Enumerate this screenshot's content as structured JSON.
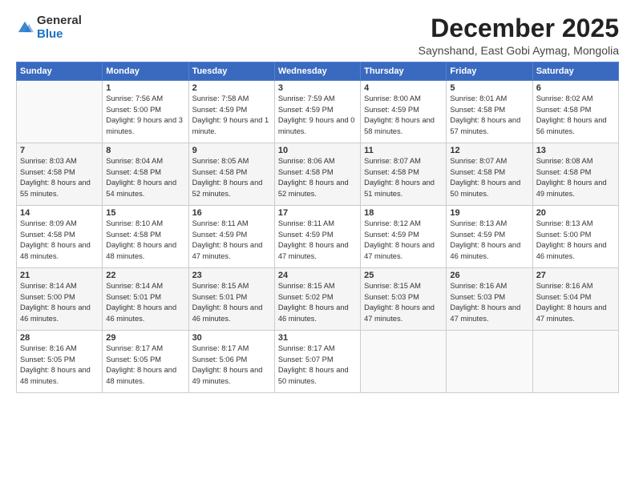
{
  "logo": {
    "general": "General",
    "blue": "Blue"
  },
  "title": "December 2025",
  "subtitle": "Saynshand, East Gobi Aymag, Mongolia",
  "headers": [
    "Sunday",
    "Monday",
    "Tuesday",
    "Wednesday",
    "Thursday",
    "Friday",
    "Saturday"
  ],
  "weeks": [
    [
      {
        "day": "",
        "info": ""
      },
      {
        "day": "1",
        "info": "Sunrise: 7:56 AM\nSunset: 5:00 PM\nDaylight: 9 hours\nand 3 minutes."
      },
      {
        "day": "2",
        "info": "Sunrise: 7:58 AM\nSunset: 4:59 PM\nDaylight: 9 hours\nand 1 minute."
      },
      {
        "day": "3",
        "info": "Sunrise: 7:59 AM\nSunset: 4:59 PM\nDaylight: 9 hours\nand 0 minutes."
      },
      {
        "day": "4",
        "info": "Sunrise: 8:00 AM\nSunset: 4:59 PM\nDaylight: 8 hours\nand 58 minutes."
      },
      {
        "day": "5",
        "info": "Sunrise: 8:01 AM\nSunset: 4:58 PM\nDaylight: 8 hours\nand 57 minutes."
      },
      {
        "day": "6",
        "info": "Sunrise: 8:02 AM\nSunset: 4:58 PM\nDaylight: 8 hours\nand 56 minutes."
      }
    ],
    [
      {
        "day": "7",
        "info": "Sunrise: 8:03 AM\nSunset: 4:58 PM\nDaylight: 8 hours\nand 55 minutes."
      },
      {
        "day": "8",
        "info": "Sunrise: 8:04 AM\nSunset: 4:58 PM\nDaylight: 8 hours\nand 54 minutes."
      },
      {
        "day": "9",
        "info": "Sunrise: 8:05 AM\nSunset: 4:58 PM\nDaylight: 8 hours\nand 52 minutes."
      },
      {
        "day": "10",
        "info": "Sunrise: 8:06 AM\nSunset: 4:58 PM\nDaylight: 8 hours\nand 52 minutes."
      },
      {
        "day": "11",
        "info": "Sunrise: 8:07 AM\nSunset: 4:58 PM\nDaylight: 8 hours\nand 51 minutes."
      },
      {
        "day": "12",
        "info": "Sunrise: 8:07 AM\nSunset: 4:58 PM\nDaylight: 8 hours\nand 50 minutes."
      },
      {
        "day": "13",
        "info": "Sunrise: 8:08 AM\nSunset: 4:58 PM\nDaylight: 8 hours\nand 49 minutes."
      }
    ],
    [
      {
        "day": "14",
        "info": "Sunrise: 8:09 AM\nSunset: 4:58 PM\nDaylight: 8 hours\nand 48 minutes."
      },
      {
        "day": "15",
        "info": "Sunrise: 8:10 AM\nSunset: 4:58 PM\nDaylight: 8 hours\nand 48 minutes."
      },
      {
        "day": "16",
        "info": "Sunrise: 8:11 AM\nSunset: 4:59 PM\nDaylight: 8 hours\nand 47 minutes."
      },
      {
        "day": "17",
        "info": "Sunrise: 8:11 AM\nSunset: 4:59 PM\nDaylight: 8 hours\nand 47 minutes."
      },
      {
        "day": "18",
        "info": "Sunrise: 8:12 AM\nSunset: 4:59 PM\nDaylight: 8 hours\nand 47 minutes."
      },
      {
        "day": "19",
        "info": "Sunrise: 8:13 AM\nSunset: 4:59 PM\nDaylight: 8 hours\nand 46 minutes."
      },
      {
        "day": "20",
        "info": "Sunrise: 8:13 AM\nSunset: 5:00 PM\nDaylight: 8 hours\nand 46 minutes."
      }
    ],
    [
      {
        "day": "21",
        "info": "Sunrise: 8:14 AM\nSunset: 5:00 PM\nDaylight: 8 hours\nand 46 minutes."
      },
      {
        "day": "22",
        "info": "Sunrise: 8:14 AM\nSunset: 5:01 PM\nDaylight: 8 hours\nand 46 minutes."
      },
      {
        "day": "23",
        "info": "Sunrise: 8:15 AM\nSunset: 5:01 PM\nDaylight: 8 hours\nand 46 minutes."
      },
      {
        "day": "24",
        "info": "Sunrise: 8:15 AM\nSunset: 5:02 PM\nDaylight: 8 hours\nand 46 minutes."
      },
      {
        "day": "25",
        "info": "Sunrise: 8:15 AM\nSunset: 5:03 PM\nDaylight: 8 hours\nand 47 minutes."
      },
      {
        "day": "26",
        "info": "Sunrise: 8:16 AM\nSunset: 5:03 PM\nDaylight: 8 hours\nand 47 minutes."
      },
      {
        "day": "27",
        "info": "Sunrise: 8:16 AM\nSunset: 5:04 PM\nDaylight: 8 hours\nand 47 minutes."
      }
    ],
    [
      {
        "day": "28",
        "info": "Sunrise: 8:16 AM\nSunset: 5:05 PM\nDaylight: 8 hours\nand 48 minutes."
      },
      {
        "day": "29",
        "info": "Sunrise: 8:17 AM\nSunset: 5:05 PM\nDaylight: 8 hours\nand 48 minutes."
      },
      {
        "day": "30",
        "info": "Sunrise: 8:17 AM\nSunset: 5:06 PM\nDaylight: 8 hours\nand 49 minutes."
      },
      {
        "day": "31",
        "info": "Sunrise: 8:17 AM\nSunset: 5:07 PM\nDaylight: 8 hours\nand 50 minutes."
      },
      {
        "day": "",
        "info": ""
      },
      {
        "day": "",
        "info": ""
      },
      {
        "day": "",
        "info": ""
      }
    ]
  ]
}
